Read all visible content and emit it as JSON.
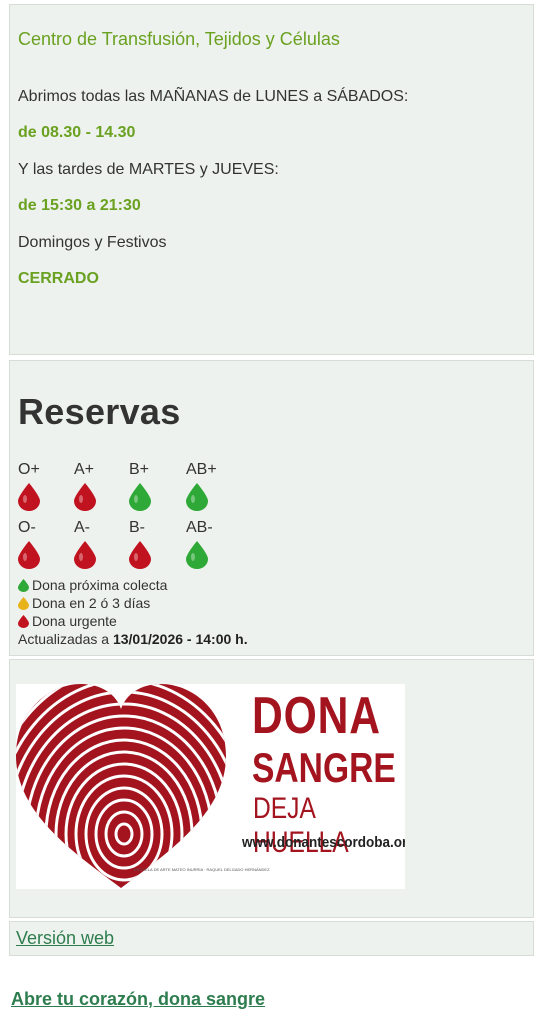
{
  "hours": {
    "title": "Centro de Transfusión, Tejidos y Células",
    "morning_text": "Abrimos todas las MAÑANAS de LUNES a SÁBADOS:",
    "morning_hours": "de 08.30 - 14.30",
    "afternoon_text": "Y las tardes de MARTES y JUEVES:",
    "afternoon_hours": "de 15:30 a 21:30",
    "holidays_text": "Domingos y Festivos",
    "holidays_status": "CERRADO"
  },
  "reserves": {
    "title": "Reservas",
    "blood_types": [
      {
        "label": "O+",
        "status": "urgent"
      },
      {
        "label": "A+",
        "status": "urgent"
      },
      {
        "label": "B+",
        "status": "ok"
      },
      {
        "label": "AB+",
        "status": "ok"
      },
      {
        "label": "O-",
        "status": "urgent"
      },
      {
        "label": "A-",
        "status": "urgent"
      },
      {
        "label": "B-",
        "status": "urgent"
      },
      {
        "label": "AB-",
        "status": "ok"
      }
    ],
    "legend": [
      {
        "label": "Dona próxima colecta",
        "color": "#2ea836"
      },
      {
        "label": "Dona en 2 ó 3 días",
        "color": "#e8b21a"
      },
      {
        "label": "Dona urgente",
        "color": "#c0131f"
      }
    ],
    "updated_prefix": "Actualizadas a",
    "updated_value": "13/01/2026 - 14:00 h."
  },
  "banner": {
    "line1": "DONA",
    "line2": "SANGRE",
    "line3": "DEJA HUELLA",
    "url": "www.donantescordoba.org",
    "credit": "ESCUELA DE ARTE MATEO INURRIA · RAQUEL DELGADO HERNÁNDEZ",
    "brand_color": "#a3141f"
  },
  "links": {
    "web_version": "Versión web",
    "footer": "Abre tu corazón, dona sangre"
  }
}
